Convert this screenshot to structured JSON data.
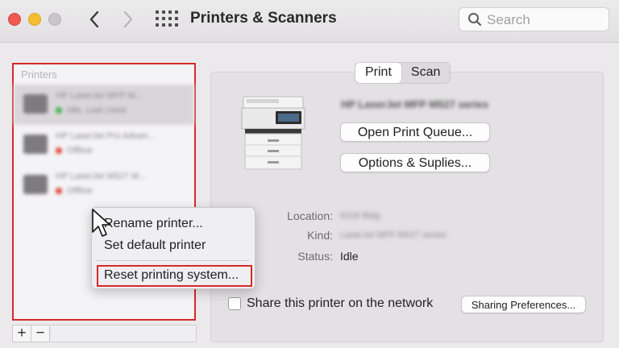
{
  "window": {
    "title": "Printers & Scanners",
    "search_placeholder": "Search"
  },
  "printers": {
    "header": "Printers",
    "items": [
      {
        "name": "HP LaserJet MFP M...",
        "status": "Idle, Last Used",
        "status_color": "#3fb24a",
        "selected": true
      },
      {
        "name": "HP LaserJet Pro Advan...",
        "status": "Offline",
        "status_color": "#e0443a",
        "selected": false
      },
      {
        "name": "HP LaserJet M527 M...",
        "status": "Offline",
        "status_color": "#e0443a",
        "selected": false
      }
    ],
    "add_label": "+",
    "remove_label": "−"
  },
  "context_menu": {
    "items": [
      "Rename printer...",
      "Set default printer",
      "Reset printing system..."
    ],
    "highlight_color": "#d62a2a"
  },
  "detail": {
    "tabs": [
      {
        "label": "Print",
        "active": true
      },
      {
        "label": "Scan",
        "active": false
      }
    ],
    "printer_name": "HP LaserJet MFP M527 series",
    "open_queue": "Open Print Queue...",
    "options_supplies": "Options & Suplies...",
    "location_label": "Location:",
    "location_value": "6216 Bldg",
    "kind_label": "Kind:",
    "kind_value": "LaserJet MFP M527 series",
    "status_label": "Status:",
    "status_value": "Idle",
    "share_label": "Share this printer on the network",
    "sharing_prefs": "Sharing Preferences..."
  }
}
